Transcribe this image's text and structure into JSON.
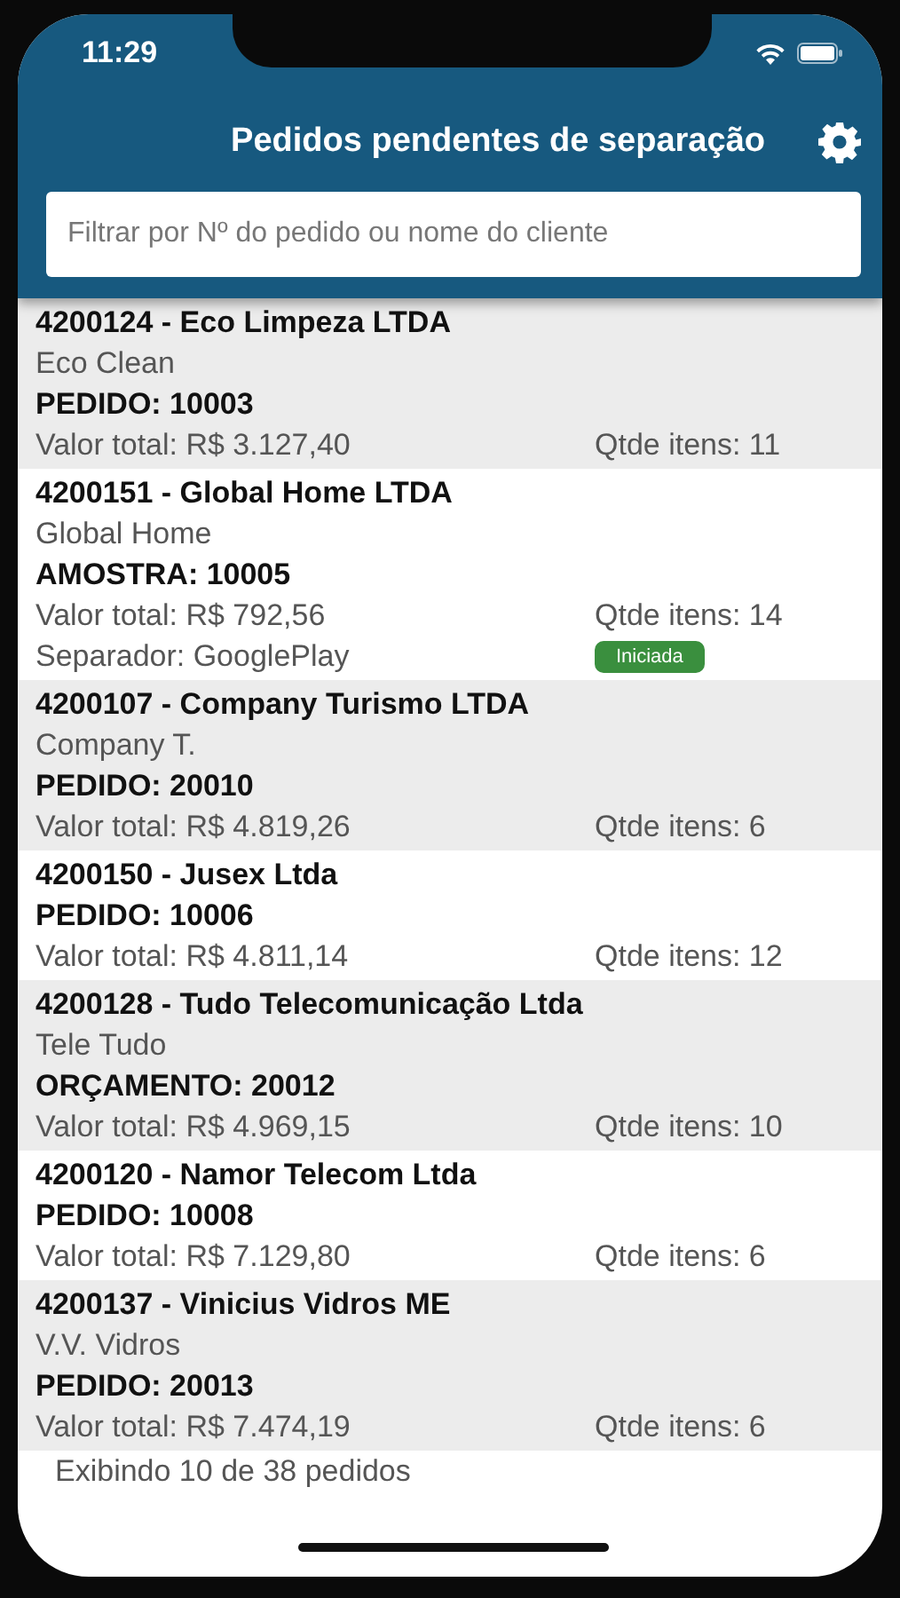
{
  "status_bar": {
    "time": "11:29"
  },
  "header": {
    "title": "Pedidos pendentes de separação"
  },
  "search": {
    "placeholder": "Filtrar por Nº do pedido ou nome do cliente"
  },
  "orders": [
    {
      "title": "4200124 - Eco Limpeza LTDA",
      "subtitle": "Eco Clean",
      "order": "PEDIDO: 10003",
      "total": "Valor total: R$ 3.127,40",
      "items": "Qtde itens: 11"
    },
    {
      "title": "4200151 - Global Home LTDA",
      "subtitle": "Global Home",
      "order": "AMOSTRA: 10005",
      "total": "Valor total: R$ 792,56",
      "items": "Qtde itens: 14",
      "separator": "Separador: GooglePlay",
      "status": "Iniciada"
    },
    {
      "title": "4200107 - Company Turismo LTDA",
      "subtitle": "Company T.",
      "order": "PEDIDO: 20010",
      "total": "Valor total: R$ 4.819,26",
      "items": "Qtde itens: 6"
    },
    {
      "title": "4200150 - Jusex Ltda",
      "order": "PEDIDO: 10006",
      "total": "Valor total: R$ 4.811,14",
      "items": "Qtde itens: 12"
    },
    {
      "title": "4200128 - Tudo Telecomunicação Ltda",
      "subtitle": "Tele Tudo",
      "order": "ORÇAMENTO: 20012",
      "total": "Valor total: R$ 4.969,15",
      "items": "Qtde itens: 10"
    },
    {
      "title": "4200120 - Namor Telecom Ltda",
      "order": "PEDIDO: 10008",
      "total": "Valor total: R$ 7.129,80",
      "items": "Qtde itens: 6"
    },
    {
      "title": "4200137 - Vinicius Vidros ME",
      "subtitle": "V.V. Vidros",
      "order": "PEDIDO: 20013",
      "total": "Valor total: R$ 7.474,19",
      "items": "Qtde itens: 6"
    }
  ],
  "footer": "Exibindo 10 de 38 pedidos"
}
